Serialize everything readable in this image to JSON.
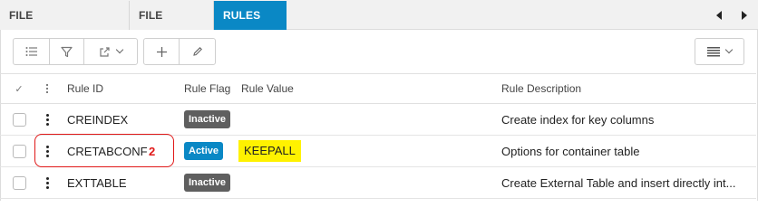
{
  "tabs": [
    {
      "label": "FILE CONFIGURATIONS"
    },
    {
      "label": "FILE MAPPING"
    },
    {
      "label": "RULES"
    }
  ],
  "table": {
    "headers": {
      "rule_id": "Rule ID",
      "rule_flag": "Rule Flag",
      "rule_value": "Rule Value",
      "rule_description": "Rule Description"
    },
    "rows": [
      {
        "rule_id": "CREINDEX",
        "rule_flag": "Inactive",
        "rule_value": "",
        "rule_description": "Create index for key columns"
      },
      {
        "rule_id": "CRETABCONF",
        "rule_flag": "Active",
        "rule_value": "KEEPALL",
        "rule_description": "Options for container table"
      },
      {
        "rule_id": "EXTTABLE",
        "rule_flag": "Inactive",
        "rule_value": "",
        "rule_description": "Create External Table and insert directly int..."
      }
    ]
  },
  "annotation": {
    "number": "2",
    "color": "#e01818"
  },
  "colors": {
    "accent": "#0a88c5",
    "inactive": "#5f5f5f",
    "highlight": "#fff200"
  },
  "icons": [
    "list-icon",
    "filter-icon",
    "export-icon",
    "plus-icon",
    "pencil-icon",
    "view-menu-icon",
    "chevron-left-icon",
    "chevron-right-icon"
  ]
}
